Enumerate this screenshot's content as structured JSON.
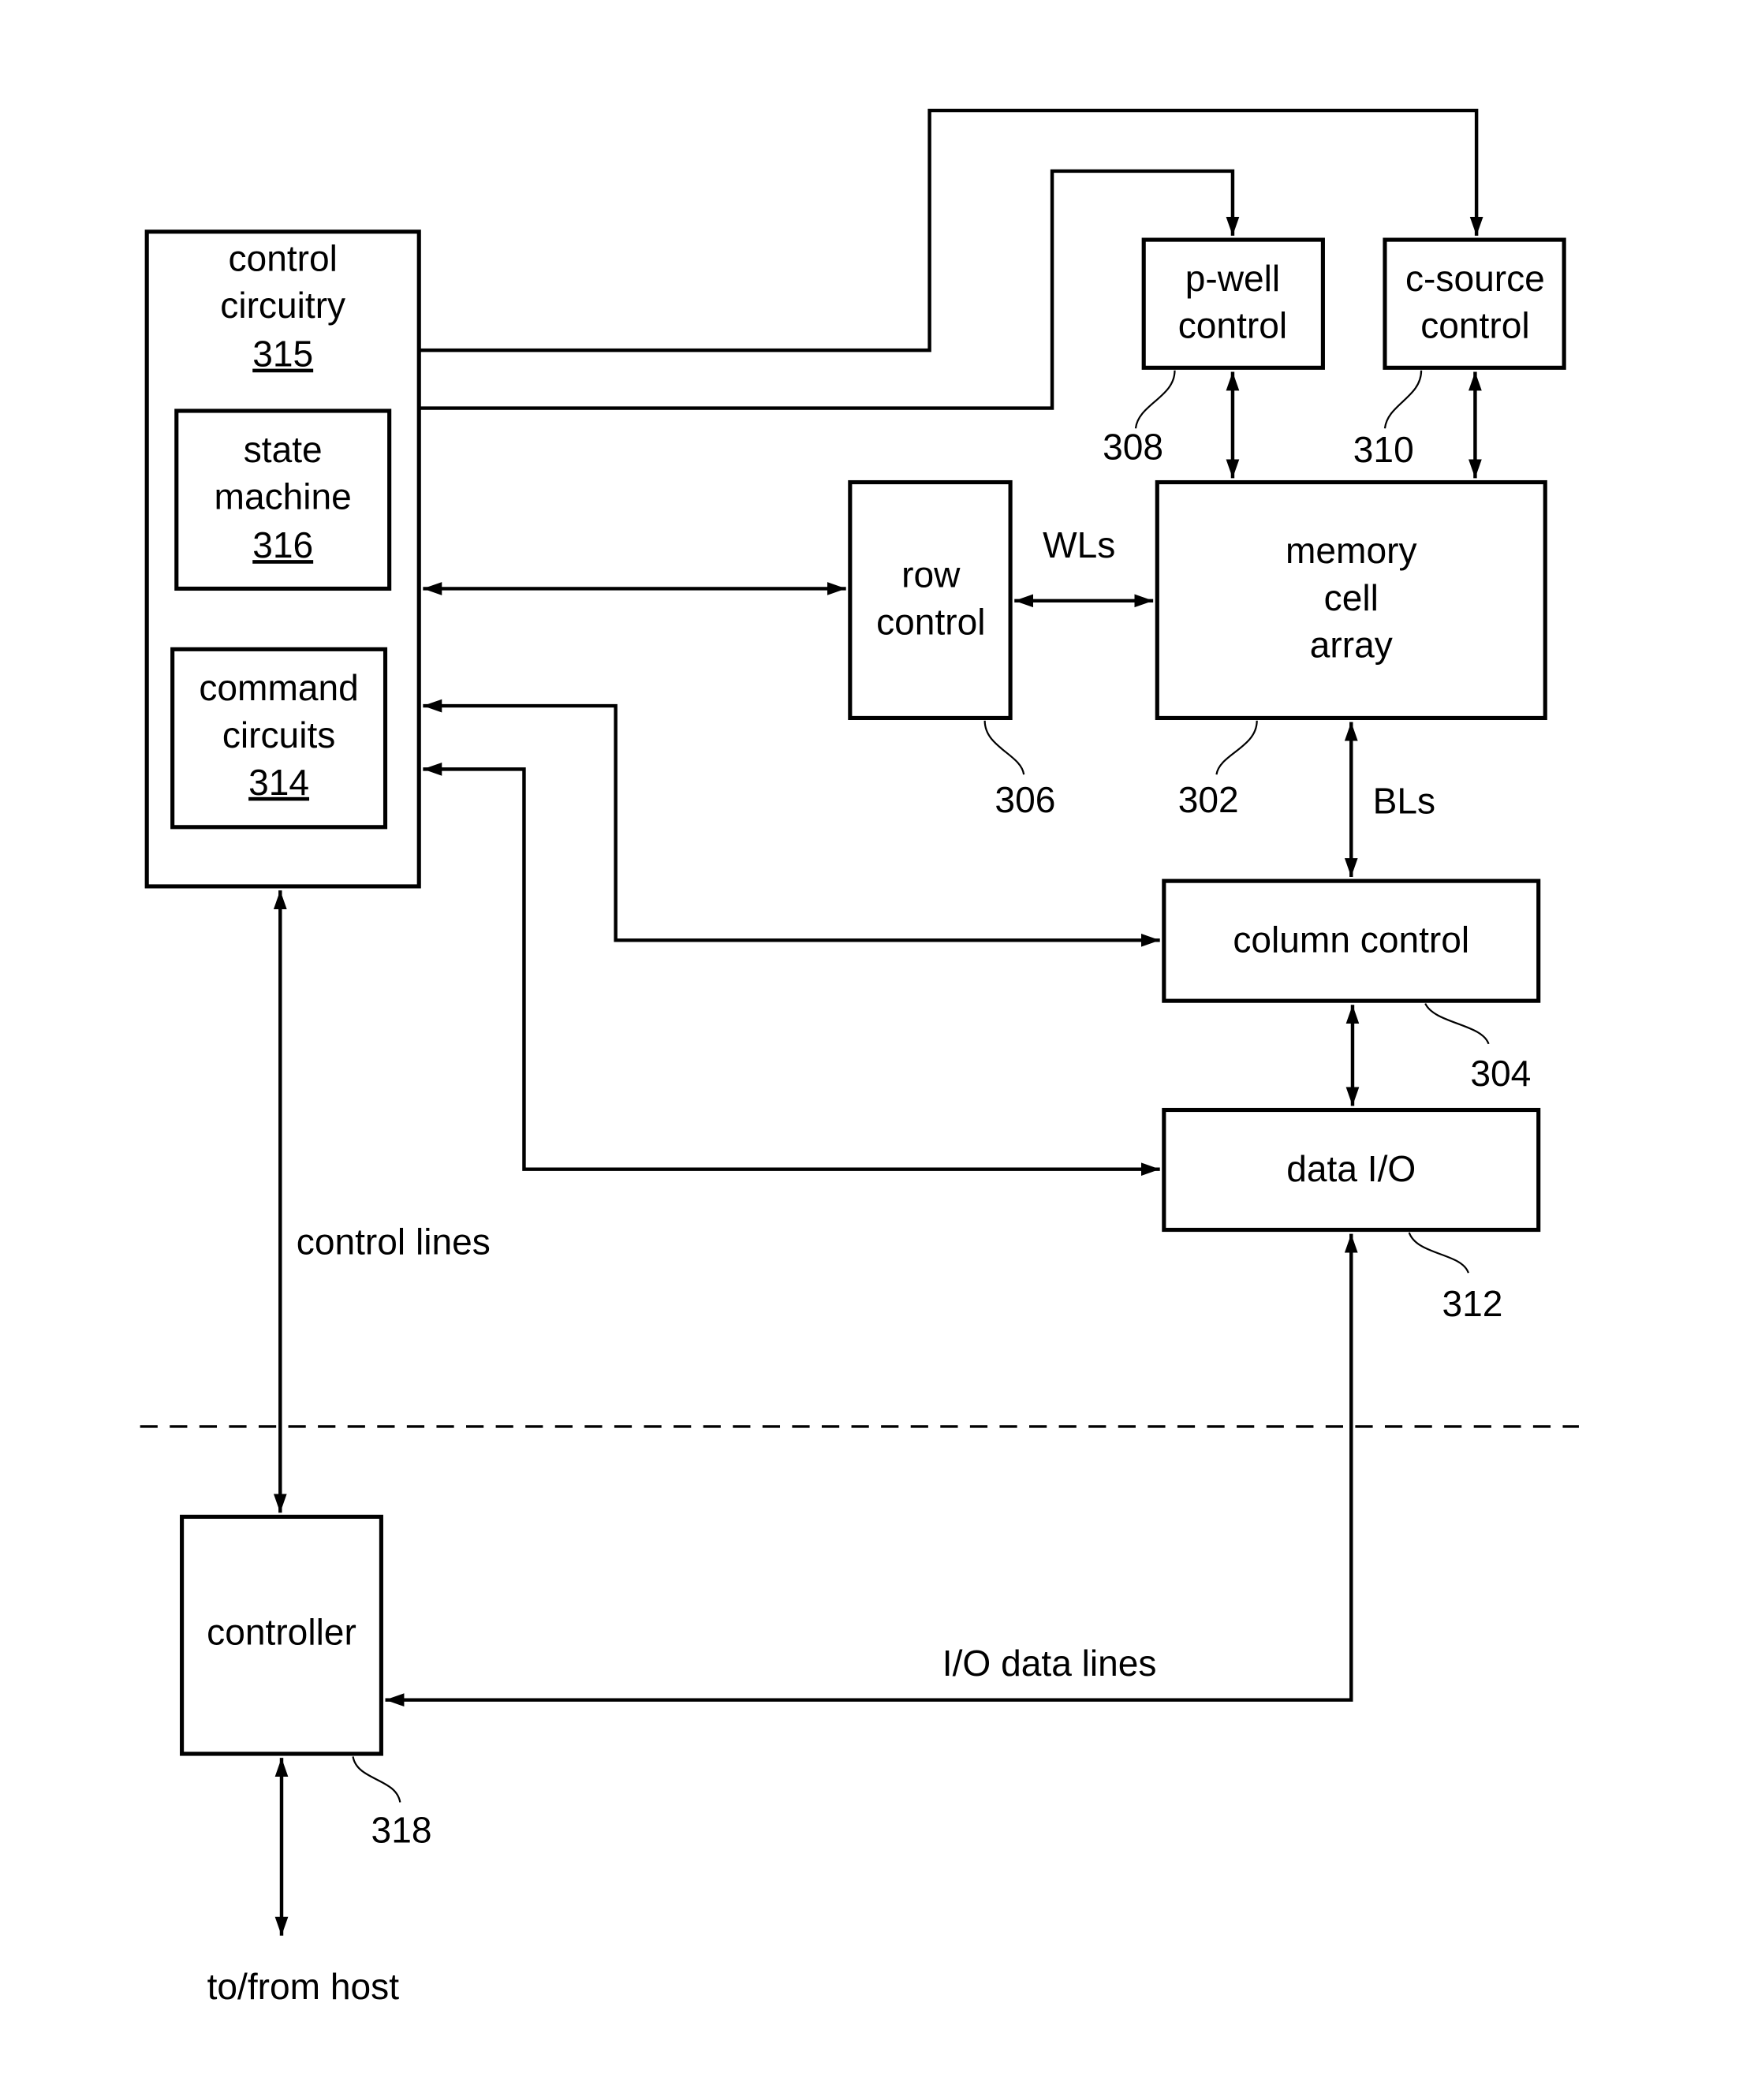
{
  "blocks": {
    "control_circuitry": {
      "line1": "control",
      "line2": "circuitry",
      "ref": "315"
    },
    "state_machine": {
      "line1": "state",
      "line2": "machine",
      "ref": "316"
    },
    "command_circuits": {
      "line1": "command",
      "line2": "circuits",
      "ref": "314"
    },
    "p_well_control": {
      "line1": "p-well",
      "line2": "control",
      "ref": "308"
    },
    "c_source_control": {
      "line1": "c-source",
      "line2": "control",
      "ref": "310"
    },
    "row_control": {
      "line1": "row",
      "line2": "control",
      "ref": "306"
    },
    "memory_cell_array": {
      "line1": "memory",
      "line2": "cell",
      "line3": "array",
      "ref": "302"
    },
    "column_control": {
      "label": "column control",
      "ref": "304"
    },
    "data_io": {
      "label": "data I/O",
      "ref": "312"
    },
    "controller": {
      "label": "controller",
      "ref": "318"
    }
  },
  "signals": {
    "wls": "WLs",
    "bls": "BLs",
    "control_lines": "control lines",
    "io_data_lines": "I/O data lines",
    "host": "to/from host"
  }
}
